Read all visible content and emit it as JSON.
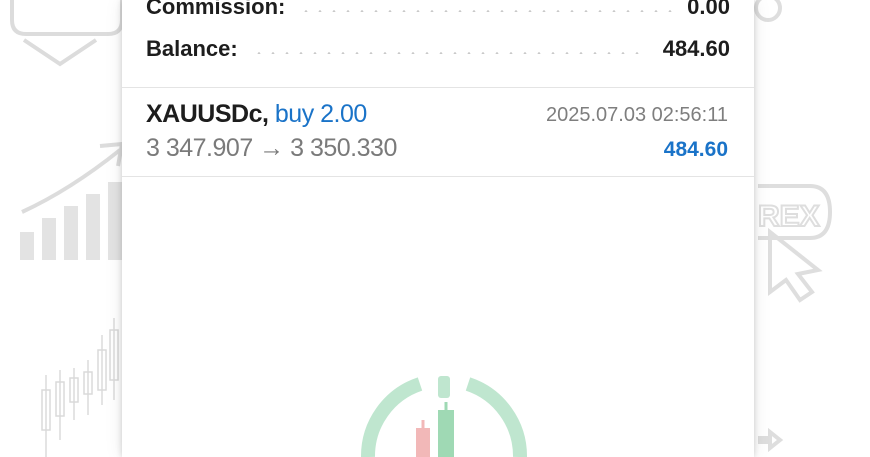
{
  "summary": {
    "commission_label": "Commission:",
    "commission_value": "0.00",
    "balance_label": "Balance:",
    "balance_value": "484.60"
  },
  "deal": {
    "symbol": "XAUUSDc",
    "action": "buy 2.00",
    "open_price": "3 347.907",
    "arrow": "→",
    "close_price": "3 350.330",
    "time": "2025.07.03 02:56:11",
    "profit": "484.60"
  },
  "colors": {
    "accent_blue": "#1a73c8",
    "logo_green": "#3cb371",
    "logo_red": "#e05555"
  }
}
